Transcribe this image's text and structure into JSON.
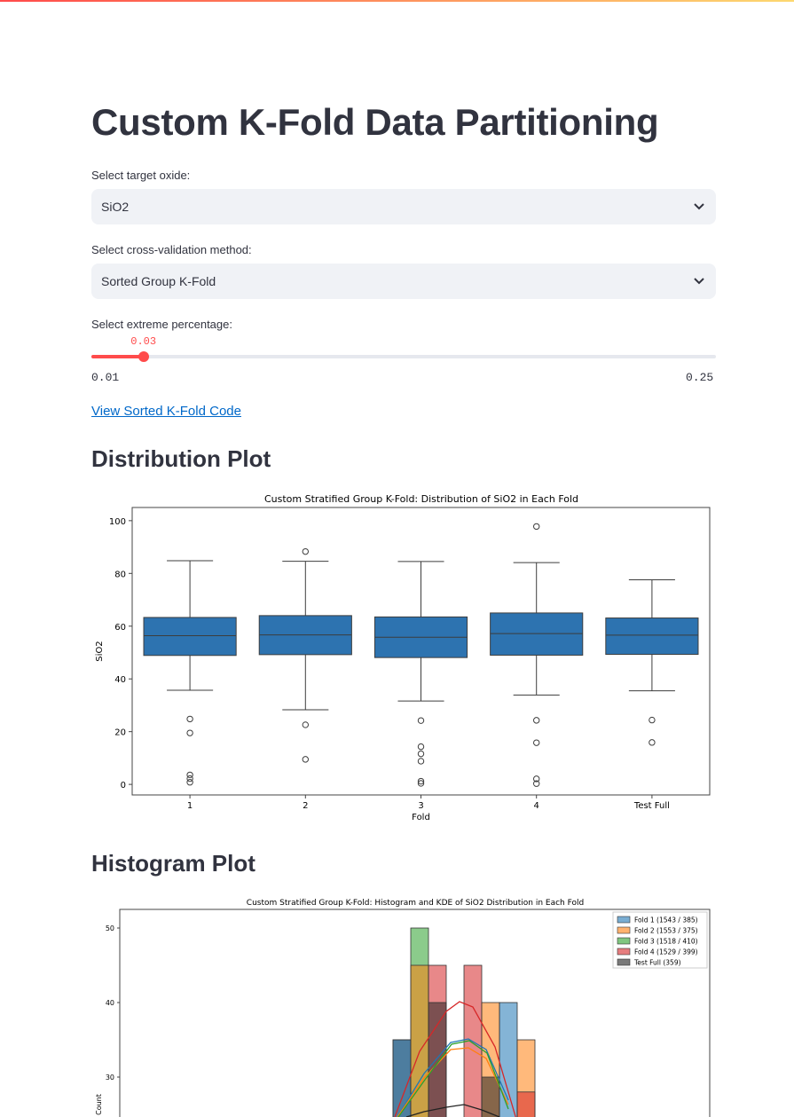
{
  "page": {
    "title": "Custom K-Fold Data Partitioning",
    "accent_color": "#ff4b4b"
  },
  "controls": {
    "target_label": "Select target oxide:",
    "target_value": "SiO2",
    "method_label": "Select cross-validation method:",
    "method_value": "Sorted Group K-Fold",
    "extreme_label": "Select extreme percentage:",
    "extreme_value": "0.03",
    "extreme_min": "0.01",
    "extreme_max": "0.25",
    "code_link": "View Sorted K-Fold Code"
  },
  "sections": {
    "distribution_heading": "Distribution Plot",
    "histogram_heading": "Histogram Plot"
  },
  "chart_data": [
    {
      "type": "box",
      "title": "Custom Stratified Group K-Fold: Distribution of SiO2 in Each Fold",
      "xlabel": "Fold",
      "ylabel": "SiO2",
      "ylim": [
        -4,
        105
      ],
      "yticks": [
        0,
        20,
        40,
        60,
        80,
        100
      ],
      "color": "#2d73b0",
      "categories": [
        "1",
        "2",
        "3",
        "4",
        "Test Full"
      ],
      "boxes": [
        {
          "whislo": 35.7,
          "q1": 48.9,
          "med": 56.4,
          "q3": 63.3,
          "whishi": 84.8,
          "fliers": [
            24.8,
            19.5,
            3.6,
            2.2,
            0.8
          ]
        },
        {
          "whislo": 28.3,
          "q1": 49.2,
          "med": 56.7,
          "q3": 64.0,
          "whishi": 84.6,
          "fliers": [
            88.3,
            22.6,
            9.5
          ]
        },
        {
          "whislo": 31.6,
          "q1": 48.1,
          "med": 55.8,
          "q3": 63.5,
          "whishi": 84.5,
          "fliers": [
            24.2,
            14.3,
            11.6,
            8.8,
            1.2,
            0.4
          ]
        },
        {
          "whislo": 33.9,
          "q1": 49.0,
          "med": 57.2,
          "q3": 65.0,
          "whishi": 84.1,
          "fliers": [
            97.8,
            24.3,
            15.8,
            2.1,
            0.3
          ]
        },
        {
          "whislo": 35.5,
          "q1": 49.3,
          "med": 56.6,
          "q3": 63.1,
          "whishi": 77.6,
          "fliers": [
            24.4,
            15.9
          ]
        }
      ]
    },
    {
      "type": "histogram",
      "title": "Custom Stratified Group K-Fold: Histogram and KDE of SiO2 Distribution in Each Fold",
      "ylabel": "Count",
      "yticks": [
        30,
        40,
        50
      ],
      "y_visible": [
        22,
        53
      ],
      "series": [
        {
          "name": "Fold 1 (1543 / 385)",
          "color": "#1f77b4"
        },
        {
          "name": "Fold 2 (1553 / 375)",
          "color": "#ff7f0e"
        },
        {
          "name": "Fold 3 (1518 / 410)",
          "color": "#2ca02c"
        },
        {
          "name": "Fold 4 (1529 / 399)",
          "color": "#d62728"
        },
        {
          "name": "Test Full (359)",
          "color": "#222222"
        }
      ],
      "visible_bars": [
        {
          "series": 2,
          "x": 0,
          "count": 50
        },
        {
          "series": 4,
          "x": -1,
          "count": 35
        },
        {
          "series": 0,
          "x": -1,
          "count": 35
        },
        {
          "series": 1,
          "x": 0,
          "count": 45
        },
        {
          "series": 3,
          "x": 1,
          "count": 45
        },
        {
          "series": 4,
          "x": 1,
          "count": 40
        },
        {
          "series": 3,
          "x": 3,
          "count": 45
        },
        {
          "series": 1,
          "x": 4,
          "count": 40
        },
        {
          "series": 0,
          "x": 5,
          "count": 40
        },
        {
          "series": 1,
          "x": 6,
          "count": 35
        },
        {
          "series": 3,
          "x": 6,
          "count": 28
        },
        {
          "series": 4,
          "x": 4,
          "count": 30
        }
      ]
    }
  ]
}
